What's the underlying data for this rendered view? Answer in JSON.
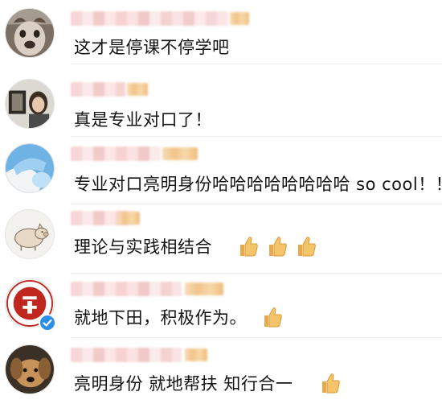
{
  "comments": [
    {
      "text": "这才是停课不停学吧",
      "avatar": "dog-face-avatar",
      "verified": false,
      "thumbs_up": 0
    },
    {
      "text": "真是专业对口了！",
      "avatar": "girl-photo-avatar",
      "verified": false,
      "thumbs_up": 0
    },
    {
      "text": "专业对口亮明身份哈哈哈哈哈哈哈哈 so cool！！",
      "avatar": "sky-blue-avatar",
      "verified": false,
      "thumbs_up": 0
    },
    {
      "text": "理论与实践相结合",
      "avatar": "pig-sketch-avatar",
      "verified": false,
      "thumbs_up": 3
    },
    {
      "text": "就地下田，积极作为。",
      "avatar": "university-logo-avatar",
      "verified": true,
      "thumbs_up": 1
    },
    {
      "text": "亮明身份 就地帮扶 知行合一",
      "avatar": "dog-photo-avatar",
      "verified": false,
      "thumbs_up": 1
    }
  ],
  "colors": {
    "verified_badge": "#2b8fe6",
    "logo_red": "#c0281f",
    "thumbs_yellow": "#f4c46a"
  }
}
